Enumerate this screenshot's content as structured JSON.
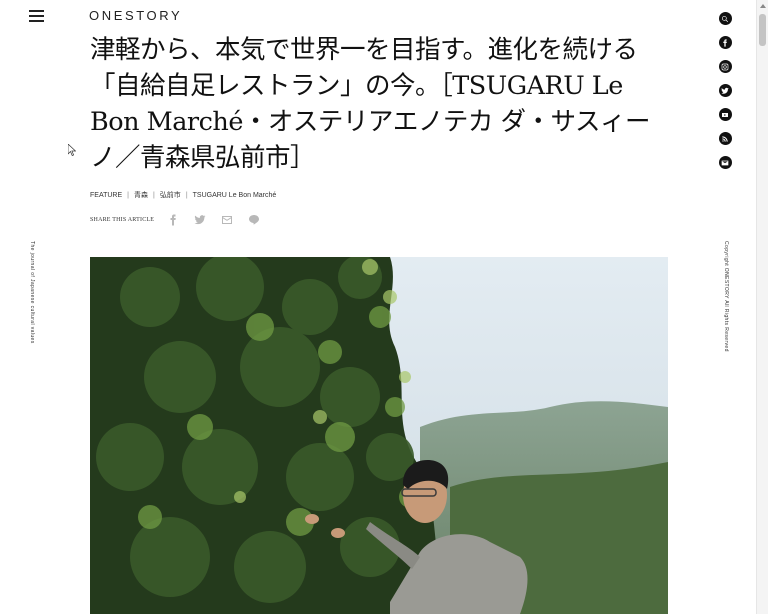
{
  "header": {
    "logo": "ONESTORY"
  },
  "article": {
    "title": "津軽から、本気で世界一を目指す。進化を続ける「自給自足レストラン」の今。［TSUGARU Le Bon Marché・オステリアエノテカ ダ・サスィーノ／青森県弘前市］",
    "tags": [
      "FEATURE",
      "青森",
      "弘前市",
      "TSUGARU Le Bon Marché"
    ],
    "share_label": "SHARE THIS ARTICLE",
    "share_icons": [
      "facebook-icon",
      "twitter-icon",
      "mail-icon",
      "line-icon"
    ]
  },
  "sidebar": {
    "left_text": "The journal of Japanese cultural values",
    "right_text": "Copyright ONESTORY All Rights Reserved",
    "social_icons": [
      "search-icon",
      "facebook-icon",
      "instagram-icon",
      "twitter-icon",
      "youtube-icon",
      "rss-icon",
      "mail-icon"
    ]
  },
  "colors": {
    "text": "#111111",
    "icon_gray": "#b8b8b8",
    "social_bg": "#111111"
  }
}
